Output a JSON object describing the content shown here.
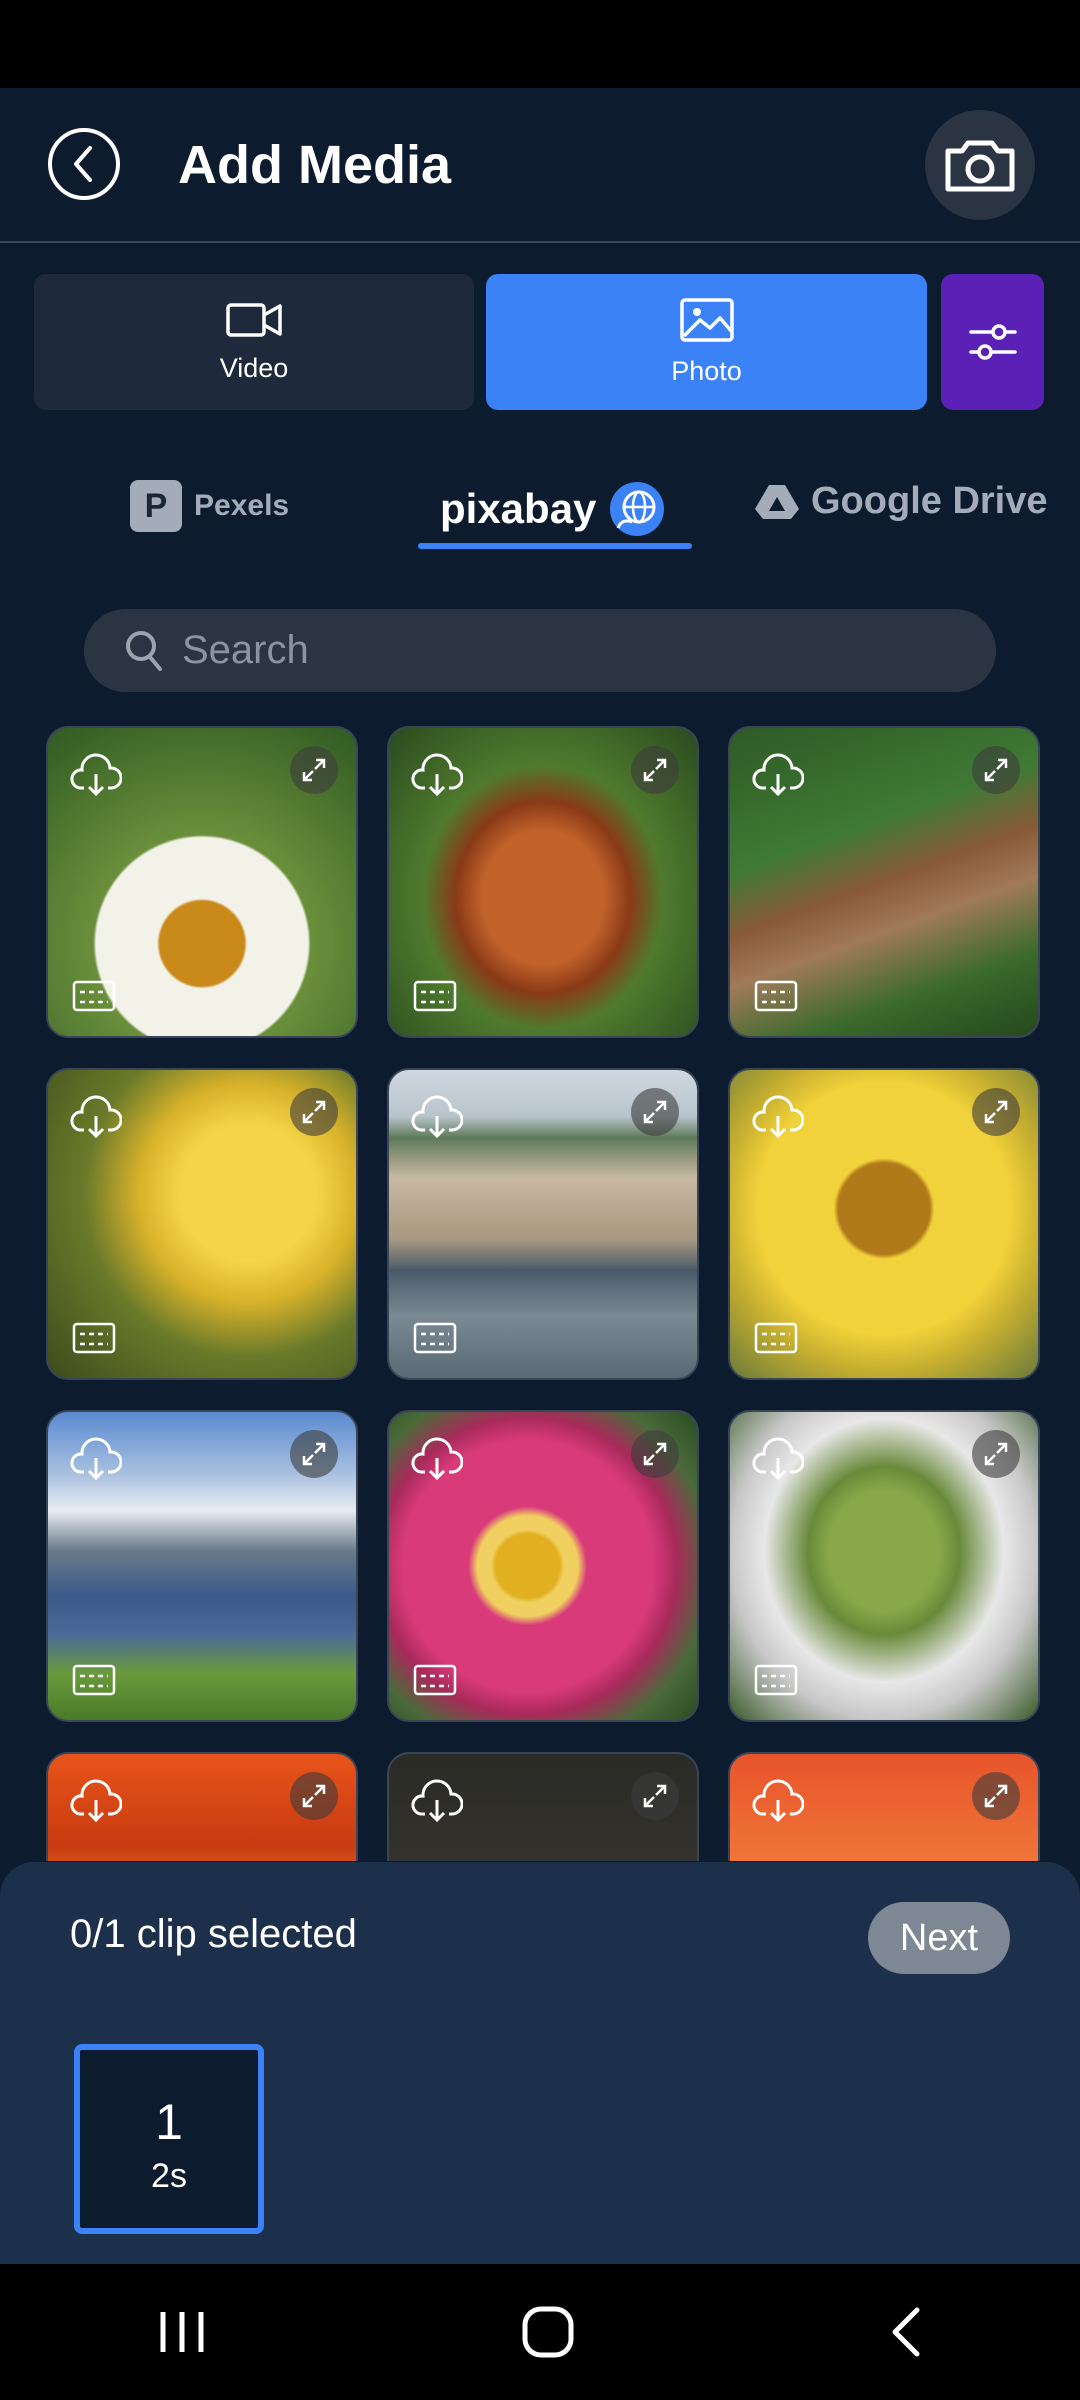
{
  "header": {
    "title": "Add Media"
  },
  "media_types": [
    {
      "label": "Video",
      "icon": "video-camera-icon",
      "selected": false
    },
    {
      "label": "Photo",
      "icon": "image-icon",
      "selected": true
    }
  ],
  "sources": {
    "pexels": "Pexels",
    "pixabay": "pixabay",
    "google_drive": "Google Drive",
    "selected": "pixabay"
  },
  "search": {
    "placeholder": "Search"
  },
  "thumbnails": [
    "bee on white coneflower",
    "red squirrel",
    "squirrel at wooden feeder",
    "wasp on yellow flower",
    "waterfront city buildings",
    "yellow flower with ladybug",
    "mountain lake",
    "pink dahlia",
    "bumblebees on thistle",
    "orange flower",
    "stones",
    "sunset illustration"
  ],
  "selection": {
    "status": "0/1 clip selected",
    "next_label": "Next",
    "clip_number": "1",
    "clip_duration": "2s"
  },
  "colors": {
    "background": "#0d1b2e",
    "accent": "#3b82f6",
    "filter": "#5b21b6",
    "sheet": "#1c2f4b"
  }
}
